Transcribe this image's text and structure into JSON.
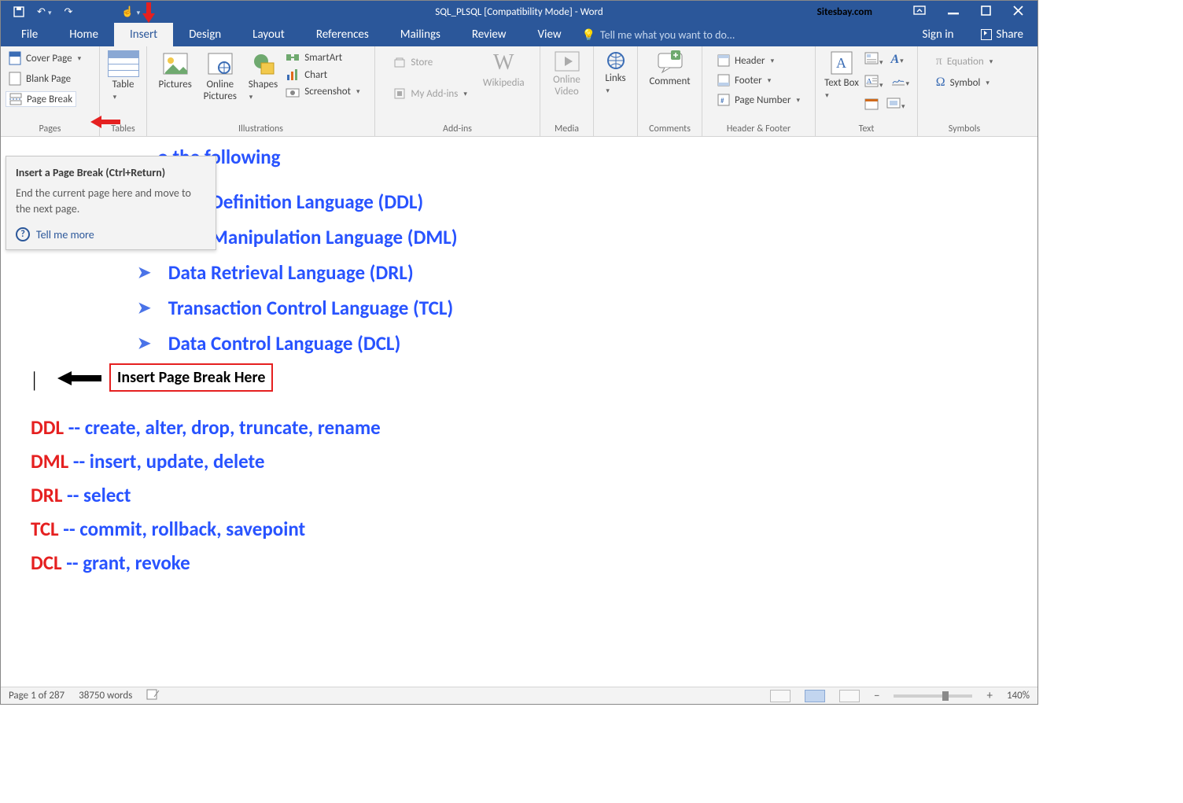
{
  "title": "SQL_PLSQL [Compatibility Mode] - Word",
  "watermark": "Sitesbay.com",
  "menuTabs": {
    "file": "File",
    "home": "Home",
    "insert": "Insert",
    "design": "Design",
    "layout": "Layout",
    "references": "References",
    "mailings": "Mailings",
    "review": "Review",
    "view": "View"
  },
  "tellme": "Tell me what you want to do...",
  "signin": "Sign in",
  "share": "Share",
  "ribbon": {
    "pages": {
      "cover": "Cover Page",
      "blank": "Blank Page",
      "pbreak": "Page Break",
      "label": "Pages"
    },
    "tables": {
      "table": "Table",
      "label": "Tables"
    },
    "illus": {
      "pictures": "Pictures",
      "online": "Online Pictures",
      "shapes": "Shapes",
      "smartart": "SmartArt",
      "chart": "Chart",
      "screenshot": "Screenshot",
      "label": "Illustrations"
    },
    "addins": {
      "store": "Store",
      "myaddins": "My Add-ins",
      "wiki": "Wikipedia",
      "label": "Add-ins"
    },
    "media": {
      "video": "Online Video",
      "label": "Media"
    },
    "links": {
      "links": "Links",
      "label": ""
    },
    "comments": {
      "comment": "Comment",
      "label": "Comments"
    },
    "hf": {
      "header": "Header",
      "footer": "Footer",
      "pagenum": "Page Number",
      "label": "Header & Footer"
    },
    "text": {
      "textbox": "Text Box",
      "label": "Text"
    },
    "symbols": {
      "eq": "Equation",
      "sym": "Symbol",
      "label": "Symbols"
    }
  },
  "tooltip": {
    "head": "Insert a Page Break (Ctrl+Return)",
    "body": "End the current page here and move to the next page.",
    "more": "Tell me more"
  },
  "doc": {
    "headingSuffix": "o the following",
    "bullets": [
      "Data Definition Language (DDL)",
      "Data Manipulation Language (DML)",
      "Data Retrieval Language (DRL)",
      "Transaction Control Language (TCL)",
      "Data Control Language (DCL)"
    ],
    "insertLabel": "Insert Page Break Here",
    "defs": [
      {
        "acr": "DDL",
        "rest": " -- create, alter, drop, truncate, rename"
      },
      {
        "acr": "DML",
        "rest": " -- insert, update, delete"
      },
      {
        "acr": "DRL",
        "rest": " -- select"
      },
      {
        "acr": "TCL",
        "rest": " -- commit, rollback, savepoint"
      },
      {
        "acr": "DCL",
        "rest": " -- grant, revoke"
      }
    ]
  },
  "status": {
    "page": "Page 1 of 287",
    "words": "38750 words",
    "zoom": "140%"
  }
}
